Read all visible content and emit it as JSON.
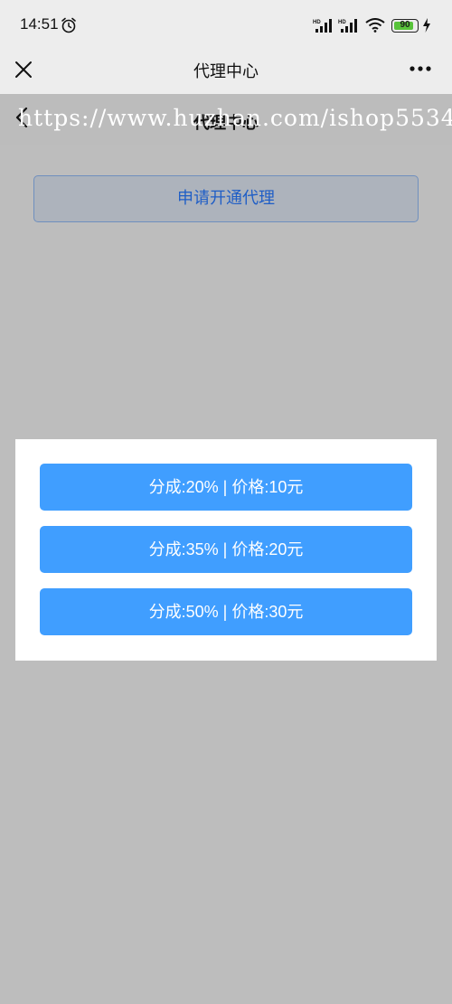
{
  "status_bar": {
    "time": "14:51",
    "battery_level": 90,
    "battery_label": "90"
  },
  "nav": {
    "title": "代理中心"
  },
  "page": {
    "title": "代理中心",
    "watermark": "https://www.huzhan.com/ishop5534"
  },
  "apply_button": {
    "label": "申请开通代理"
  },
  "plans": [
    {
      "label": "分成:20% | 价格:10元"
    },
    {
      "label": "分成:35% | 价格:20元"
    },
    {
      "label": "分成:50% | 价格:30元"
    }
  ],
  "colors": {
    "plan_button": "#409eff",
    "apply_text": "#1f5ec6",
    "overlay": "#bdbdbd"
  },
  "icons": [
    "alarm-icon",
    "signal-icon",
    "wifi-icon",
    "bolt-icon",
    "close-icon",
    "more-icon",
    "back-icon"
  ]
}
